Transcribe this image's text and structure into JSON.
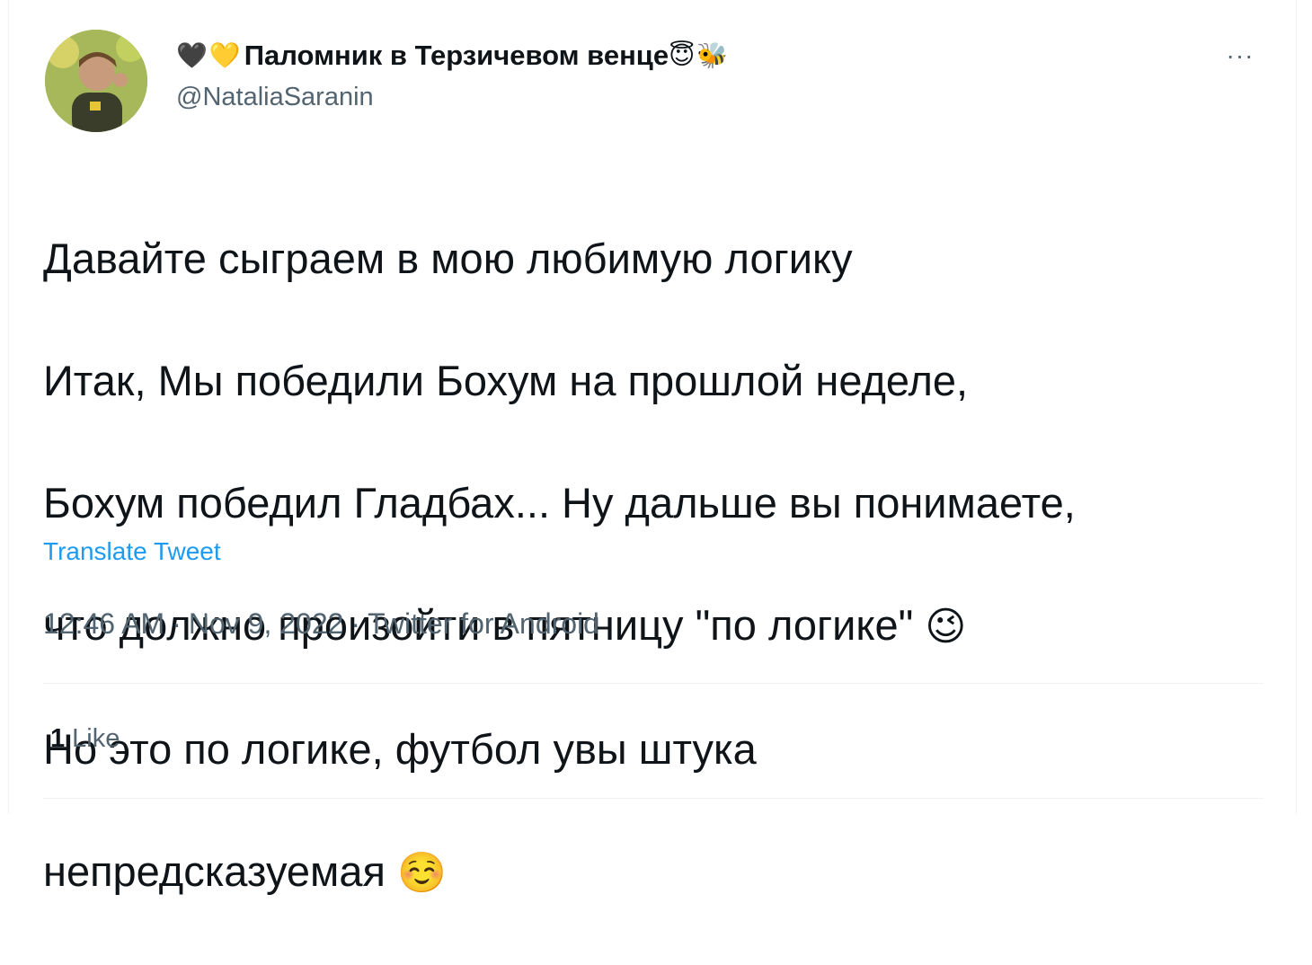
{
  "author": {
    "name_emojis": [
      "🖤",
      "💛"
    ],
    "display_name": "Паломник в Терзичевом венце",
    "name_suffix_emojis": [
      "😇",
      "🐝"
    ],
    "handle": "@NataliaSaranin",
    "avatar_icon": "profile-photo"
  },
  "more_icon": "···",
  "tweet": {
    "lines": [
      "Давайте сыграем в мою любимую логику",
      "Итак, Мы победили Бохум на прошлой неделе,",
      "Бохум победил Гладбах... Ну дальше вы понимаете,",
      "что должно произойти в пятницу \"по логике\" ",
      "Но это по логике, футбол увы штука",
      "непредсказуемая "
    ],
    "emoji_line4": "😉",
    "emoji_line6": "☺️",
    "translate_label": "Translate Tweet"
  },
  "meta": {
    "time": "12:46 AM",
    "separator": "·",
    "date": "Nov 9, 2022",
    "source": "Twitter for Android"
  },
  "stats": {
    "likes_count": "1",
    "likes_label": "Like"
  },
  "colors": {
    "text": "#0f1419",
    "secondary": "#536471",
    "link": "#1d9bf0",
    "divider": "#eff3f4"
  }
}
